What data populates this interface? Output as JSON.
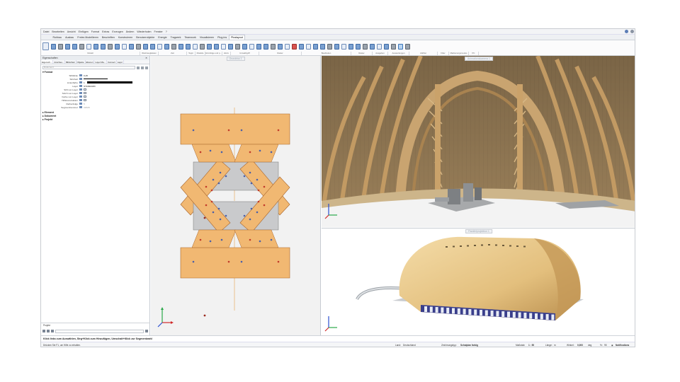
{
  "menu": [
    "Datei",
    "Bearbeiten",
    "Ansicht",
    "Einfügen",
    "Format",
    "Extras",
    "Erzeugen",
    "Ändern",
    "Wiederholen",
    "Fenster",
    "?"
  ],
  "tabs": [
    "Rohbau",
    "Ausbau",
    "Freies Modellieren",
    "Beschriften",
    "Konstruieren",
    "Benutzerobjekte",
    "Energie",
    "Tragwerk",
    "Teamwork",
    "Visualisieren",
    "Plug-ins",
    "Pluslayout"
  ],
  "active_tab": "Pluslayout",
  "ribbon_groups": [
    "Modell",
    "Werkzeugkästen",
    "Zeit",
    "Teppi",
    "Modelle",
    "Hinzufüge und p...",
    "Hinzu",
    "Umwälzgriff",
    "Raster",
    "Bearbeiten",
    "Raster",
    "Ausgeben",
    "Auswertungen",
    "Attribut",
    "Filter",
    "Markierungsmodus",
    "PC"
  ],
  "panel": {
    "title": "Eigenschaften",
    "tabs": [
      "Eigensch...",
      "Anschau...",
      "Bibliothek",
      "Objekte",
      "Ebenen",
      "Layer Ma...",
      "Connect",
      "Layer"
    ],
    "selector": "Dokument",
    "format_title": "Format",
    "rows": [
      {
        "label": "Stiftdicke",
        "value": "0,25"
      },
      {
        "label": "Strichart",
        "value": ""
      },
      {
        "label": "Linienfarbe",
        "value": "1"
      },
      {
        "label": "Layer",
        "value": "STANDARD"
      },
      {
        "label": "Stift von Layer",
        "value": ""
      },
      {
        "label": "Strich von Layer",
        "value": ""
      },
      {
        "label": "Farbe von Layer",
        "value": ""
      },
      {
        "label": "Hilfskonstruktion",
        "value": ""
      },
      {
        "label": "Reihenfolge",
        "value": "5"
      },
      {
        "label": "Segmentnummer",
        "value": "32028"
      }
    ],
    "collapsed": [
      "Element",
      "Dokument",
      "Projekt"
    ],
    "bottom_label": "Projekt"
  },
  "viewports": {
    "top": "Grundriss 1",
    "right_top": "Animationskamera 1",
    "right_bottom": "Parallelprojektion 1"
  },
  "status_hint": "Klick links zum Auswählen, Strg+Klick zum Hinzufügen, Umschalt+Klick zur Segmentwahl",
  "status_help": "Drücken Sie F1, um Hilfe zu erhalten.",
  "status_fields": {
    "land_label": "Land:",
    "land_value": "Deutschland",
    "draw_label": "Zeichnungstyp:",
    "draw_value": "Schalplan farbig",
    "scale_label": "Maßstab:",
    "scale_value": "1 : 50",
    "length_label": "Länge:",
    "length_value": "m",
    "angle_label": "Winkel:",
    "angle_value": "0,000",
    "angle_unit": "deg",
    "zoom_label": "%:",
    "zoom_value": "95",
    "notify": "Notifications"
  },
  "colors": {
    "wood": "#f1b872",
    "wood_dark": "#a9662c",
    "plate": "#c9cacc",
    "bolt_blue": "#4a5fa8",
    "bolt_red": "#c23a2a"
  }
}
